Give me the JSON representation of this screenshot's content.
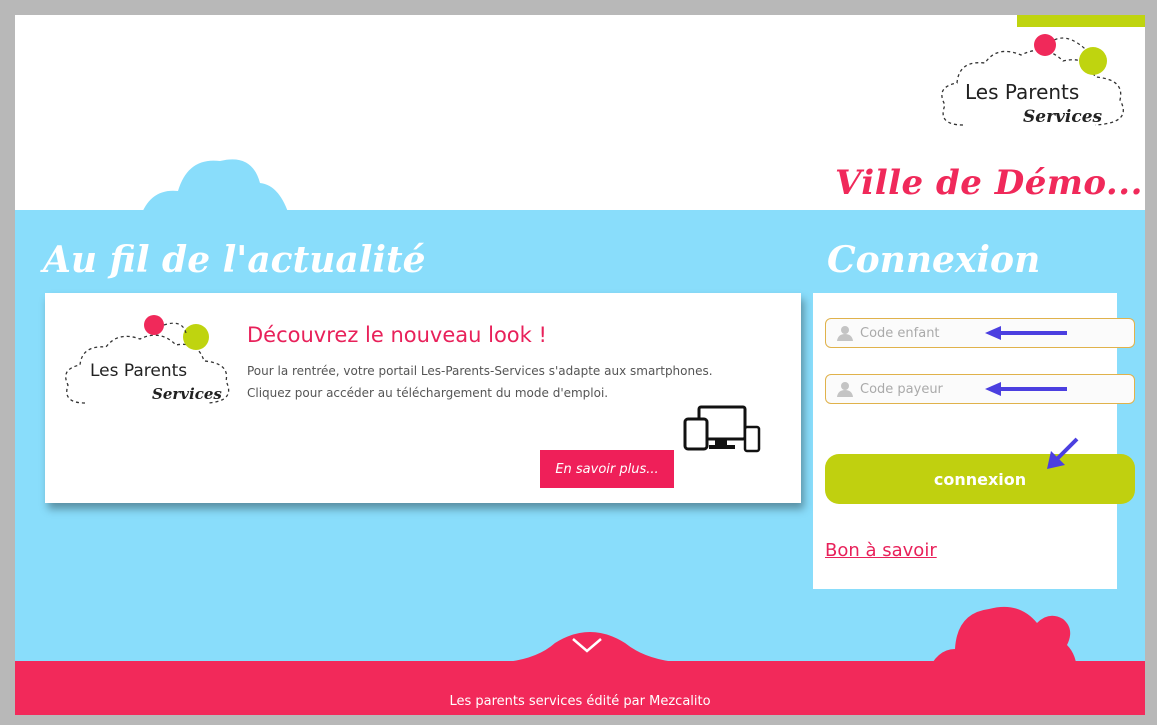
{
  "brand": {
    "line1": "Les Parents",
    "line2": "Services"
  },
  "header": {
    "town": "Ville de Démo..."
  },
  "news": {
    "section_title": "Au fil de l'actualité",
    "heading": "Découvrez le nouveau look !",
    "paragraph1": "Pour la rentrée, votre portail Les-Parents-Services s'adapte aux smartphones.",
    "paragraph2": "Cliquez pour accéder au téléchargement du mode d'emploi.",
    "more_label": "En savoir plus..."
  },
  "login": {
    "section_title": "Connexion",
    "child_code_placeholder": "Code enfant",
    "payer_code_placeholder": "Code payeur",
    "submit_label": "connexion",
    "info_link": "Bon à savoir"
  },
  "footer": {
    "text": "Les parents services édité par Mezcalito"
  },
  "colors": {
    "pink": "#f2295a",
    "lime": "#c0d00f",
    "sky": "#89ddfb",
    "arrow": "#4b3fe0"
  },
  "icons": [
    "user-icon",
    "devices-icon",
    "chevron-down-icon",
    "arrow-icon"
  ]
}
